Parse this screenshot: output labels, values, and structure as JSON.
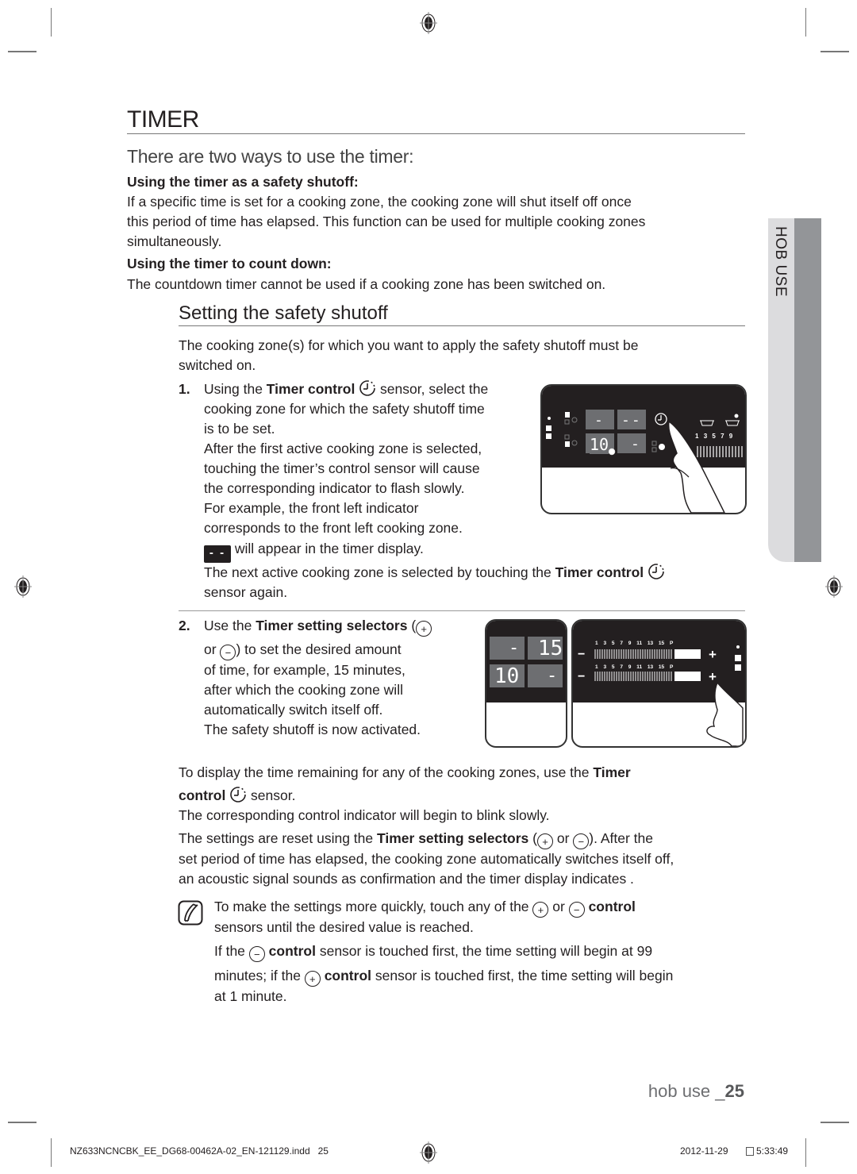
{
  "page": {
    "title": "TIMER",
    "lead": "There are two ways to use the timer:",
    "ways": [
      {
        "heading": "Using the timer as a safety shutoff:",
        "text_lines": [
          "If a specific time is set for a cooking zone, the cooking zone will shut itself off once",
          "this period of time has elapsed. This function can be used for multiple cooking zones",
          "simultaneously."
        ]
      },
      {
        "heading": "Using the timer to count down:",
        "text_lines": [
          "The countdown timer cannot be used if a cooking zone has been switched on."
        ]
      }
    ],
    "section": {
      "title": "Setting the safety shutoff",
      "intro_lines": [
        "The cooking zone(s) for which you want to apply the safety shutoff must be",
        "switched on."
      ],
      "step1": {
        "number": "1.",
        "pre": "Using the ",
        "bold": "Timer control",
        "post": " sensor, select the",
        "lines": [
          "cooking zone for which the safety shutoff time",
          "is to be set.",
          "After the first active cooking zone is selected,",
          "touching the timer’s control sensor will cause",
          "the corresponding indicator to flash slowly.",
          "For example, the front left indicator",
          "corresponds to the front left cooking zone."
        ],
        "dash_symbol": "- -",
        "dash_text": " will appear in the timer display.",
        "next_pre": "The next active cooking zone is selected by touching the ",
        "next_bold": "Timer control",
        "next_post": "sensor again."
      },
      "step2": {
        "number": "2.",
        "pre": "Use the ",
        "bold": "Timer setting selectors",
        "open": " (",
        "line2_pre": "or ",
        "line2_post": ") to set the desired amount",
        "lines": [
          "of time, for example, 15 minutes,",
          "after which the cooking zone will",
          "automatically switch itself off.",
          "The safety shutoff is now activated."
        ]
      },
      "display_remaining": {
        "pre": "To display the time remaining for any of the cooking zones, use the ",
        "bold1": "Timer",
        "bold2": "control",
        "post": " sensor.",
        "line3": "The corresponding control indicator will begin to blink slowly."
      },
      "reset": {
        "pre": "The settings are reset using the ",
        "bold": "Timer setting selectors",
        "mid": " (",
        "or": " or ",
        "post": "). After the",
        "lines": [
          "set period of time has elapsed, the cooking zone automatically switches itself off,",
          "an acoustic signal sounds as confirmation and the timer display indicates ."
        ]
      },
      "note": {
        "line1_pre": "To make the settings more quickly, touch any of the ",
        "line1_or": " or ",
        "line1_bold": "control",
        "line2": "sensors until the desired value is reached.",
        "line3_pre": "If the ",
        "line3_bold": "control",
        "line3_post": " sensor is touched first, the time setting will begin at 99",
        "line4_pre": "minutes; if the ",
        "line4_bold": "control",
        "line4_post": " sensor is touched first, the time setting will begin",
        "line5": "at 1 minute."
      }
    },
    "symbols": {
      "plus": "+",
      "minus": "−"
    },
    "side_tab": "HOB USE",
    "footer": {
      "section": "hob use _",
      "page_number": "25",
      "slug_file": "NZ633NCNCBK_EE_DG68-00462A-02_EN-121129.indd   25",
      "slug_date": "2012-11-29",
      "slug_time": "5:33:49"
    },
    "illustration1": {
      "top_left_display": "-",
      "top_right_display": "--",
      "bottom_left_display": "10",
      "bottom_right_display": "-",
      "scale_labels": [
        "1",
        "3",
        "5",
        "7",
        "9"
      ]
    },
    "illustration2": {
      "top_left_display": "-",
      "top_right_display": "15",
      "bottom_left_display": "10",
      "bottom_right_display": "-",
      "scale_labels": [
        "1",
        "3",
        "5",
        "7",
        "9",
        "11",
        "13",
        "15",
        "P"
      ],
      "minus": "−",
      "plus": "+"
    },
    "colors": {
      "text": "#231f20",
      "rule": "#777777",
      "panel_black": "#231f20",
      "segment_grey": "#6d6e71",
      "tab_light": "#dcdcde",
      "tab_dark": "#939598"
    }
  }
}
